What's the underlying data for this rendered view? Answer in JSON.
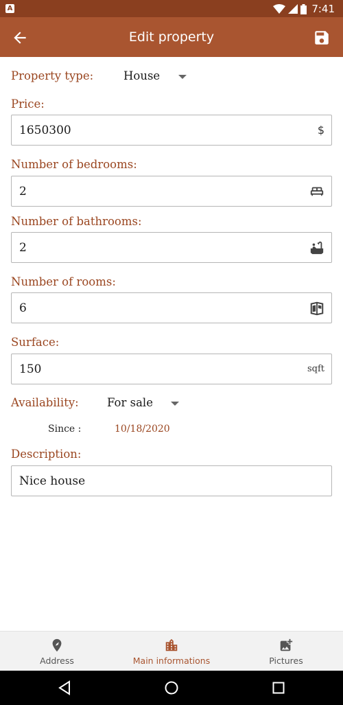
{
  "status_bar": {
    "badge": "A",
    "time": "7:41"
  },
  "app_bar": {
    "title": "Edit property",
    "back_icon": "arrow-back-icon",
    "save_icon": "save-icon"
  },
  "form": {
    "property_type": {
      "label": "Property type:",
      "value": "House"
    },
    "price": {
      "label": "Price:",
      "value": "1650300",
      "suffix": "$"
    },
    "bedrooms": {
      "label": "Number of bedrooms:",
      "value": "2",
      "icon": "bed-icon"
    },
    "bathrooms": {
      "label": "Number of bathrooms:",
      "value": "2",
      "icon": "bathtub-icon"
    },
    "rooms": {
      "label": "Number of rooms:",
      "value": "6",
      "icon": "rooms-icon"
    },
    "surface": {
      "label": "Surface:",
      "value": "150",
      "suffix": "sqft"
    },
    "availability": {
      "label": "Availability:",
      "value": "For sale",
      "since_label": "Since :",
      "since_date": "10/18/2020"
    },
    "description": {
      "label": "Description:",
      "value": "Nice house"
    }
  },
  "bottom_nav": [
    {
      "label": "Address",
      "icon": "location-pin-icon",
      "active": false
    },
    {
      "label": "Main informations",
      "icon": "building-icon",
      "active": true
    },
    {
      "label": "Pictures",
      "icon": "add-photo-icon",
      "active": false
    }
  ],
  "colors": {
    "status_bar": "#8a3f1f",
    "app_bar": "#a95530",
    "accent_text": "#9a4620"
  }
}
